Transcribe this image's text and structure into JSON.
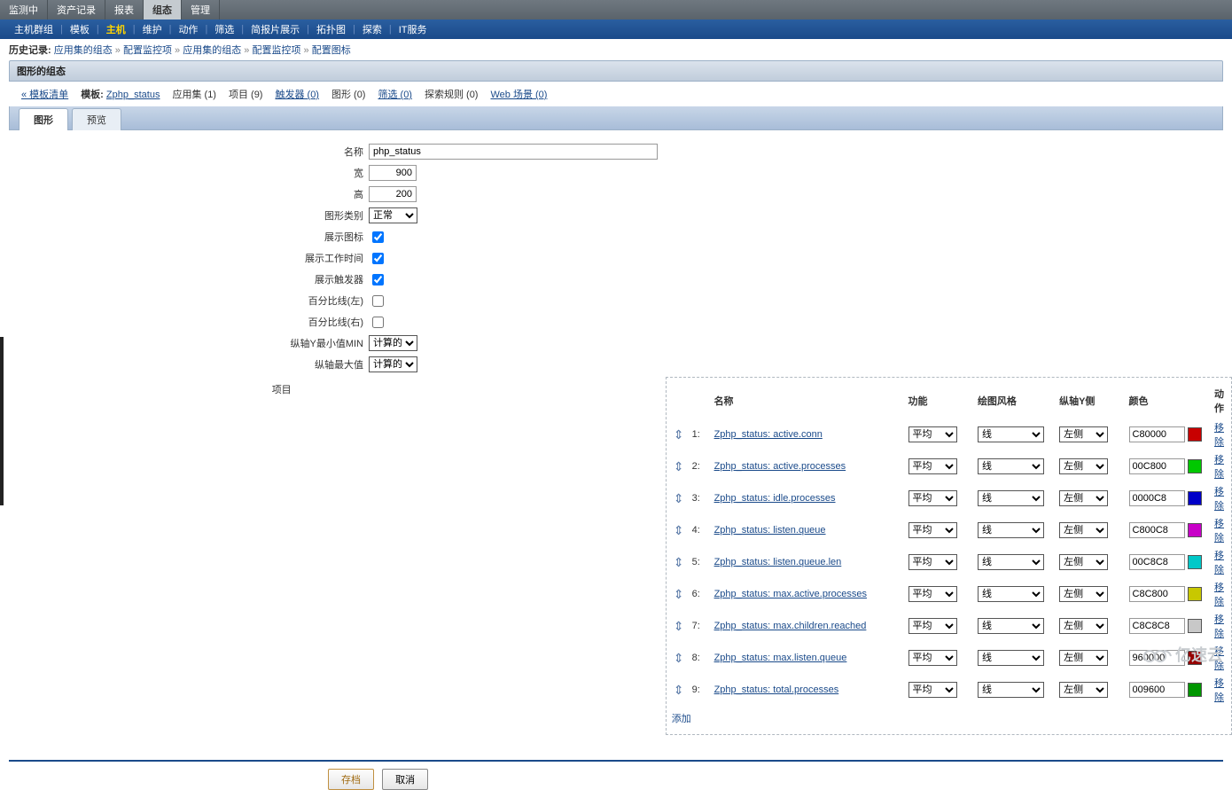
{
  "topNav": {
    "items": [
      "监测中",
      "资产记录",
      "报表",
      "组态",
      "管理"
    ],
    "activeIndex": 3
  },
  "subNav": {
    "items": [
      "主机群组",
      "模板",
      "主机",
      "维护",
      "动作",
      "筛选",
      "简报片展示",
      "拓扑图",
      "探索",
      "IT服务"
    ],
    "activeIndex": 2
  },
  "history": {
    "label": "历史记录:",
    "items": [
      "应用集的组态",
      "配置监控项",
      "应用集的组态",
      "配置监控项",
      "配置图标"
    ],
    "sep": "»"
  },
  "section": {
    "title": "图形的组态"
  },
  "crumbs": {
    "back": "« 模板清单",
    "templateLabel": "模板:",
    "templateLink": "Zphp_status",
    "appset": "应用集 (1)",
    "items": "项目 (9)",
    "trigger": "触发器 (0)",
    "graph": "图形 (0)",
    "filter": "筛选 (0)",
    "discovery": "探索规则 (0)",
    "web": "Web 场景 (0)"
  },
  "tabs": {
    "t1": "图形",
    "t2": "预览"
  },
  "form": {
    "nameLbl": "名称",
    "nameVal": "php_status",
    "widthLbl": "宽",
    "widthVal": "900",
    "heightLbl": "高",
    "heightVal": "200",
    "gtypeLbl": "图形类别",
    "gtypeVal": "正常",
    "legendLbl": "展示图标",
    "worktimeLbl": "展示工作时间",
    "trigLbl": "展示触发器",
    "pctLeftLbl": "百分比线(左)",
    "pctRightLbl": "百分比线(右)",
    "yminLbl": "纵轴Y最小值MIN",
    "yminVal": "计算的",
    "ymaxLbl": "纵轴最大值",
    "ymaxVal": "计算的",
    "itemsLbl": "项目"
  },
  "itemsTable": {
    "headers": {
      "name": "名称",
      "func": "功能",
      "style": "绘图风格",
      "yaxis": "纵轴Y侧",
      "color": "颜色",
      "action": "动作"
    },
    "funcOpt": "平均",
    "styleOpt": "线",
    "sideOpt": "左侧",
    "remove": "移除",
    "add": "添加",
    "rows": [
      {
        "idx": "1:",
        "name": "Zphp_status: active.conn",
        "color": "C80000"
      },
      {
        "idx": "2:",
        "name": "Zphp_status: active.processes",
        "color": "00C800"
      },
      {
        "idx": "3:",
        "name": "Zphp_status: idle.processes",
        "color": "0000C8"
      },
      {
        "idx": "4:",
        "name": "Zphp_status: listen.queue",
        "color": "C800C8"
      },
      {
        "idx": "5:",
        "name": "Zphp_status: listen.queue.len",
        "color": "00C8C8"
      },
      {
        "idx": "6:",
        "name": "Zphp_status: max.active.processes",
        "color": "C8C800"
      },
      {
        "idx": "7:",
        "name": "Zphp_status: max.children.reached",
        "color": "C8C8C8"
      },
      {
        "idx": "8:",
        "name": "Zphp_status: max.listen.queue",
        "color": "960000"
      },
      {
        "idx": "9:",
        "name": "Zphp_status: total.processes",
        "color": "009600"
      }
    ]
  },
  "buttons": {
    "save": "存档",
    "cancel": "取消"
  },
  "watermark": "亿速云"
}
